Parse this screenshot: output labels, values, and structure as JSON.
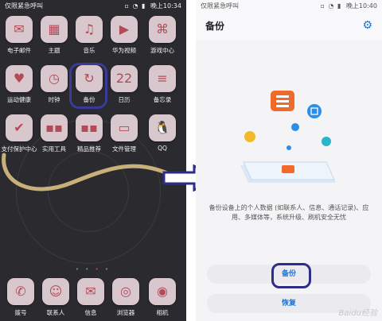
{
  "left_screen": {
    "status": {
      "carrier": "仅限紧急呼叫",
      "time": "晚上10:34"
    },
    "apps": [
      {
        "label": "电子邮件",
        "icon": "mail-icon",
        "glyph": "✉"
      },
      {
        "label": "主题",
        "icon": "theme-icon",
        "glyph": "▦"
      },
      {
        "label": "音乐",
        "icon": "music-icon",
        "glyph": "♫"
      },
      {
        "label": "华为视频",
        "icon": "video-icon",
        "glyph": "▶"
      },
      {
        "label": "游戏中心",
        "icon": "game-icon",
        "glyph": "⌘"
      },
      {
        "label": "运动健康",
        "icon": "health-icon",
        "glyph": "♥"
      },
      {
        "label": "时钟",
        "icon": "clock-icon",
        "glyph": "◷"
      },
      {
        "label": "备份",
        "icon": "backup-icon",
        "glyph": "↻"
      },
      {
        "label": "日历",
        "icon": "calendar-icon",
        "glyph": "22"
      },
      {
        "label": "备忘录",
        "icon": "memo-icon",
        "glyph": "≡"
      },
      {
        "label": "支付保护中心",
        "icon": "shield-icon",
        "glyph": "✔"
      },
      {
        "label": "实用工具",
        "icon": "tools-folder-icon",
        "glyph": "▪▪"
      },
      {
        "label": "精品推荐",
        "icon": "recommend-folder-icon",
        "glyph": "▪▪"
      },
      {
        "label": "文件管理",
        "icon": "folder-icon",
        "glyph": "▭"
      },
      {
        "label": "QQ",
        "icon": "qq-icon",
        "glyph": "🐧"
      }
    ],
    "dock": [
      {
        "label": "拨号",
        "icon": "phone-icon",
        "glyph": "✆"
      },
      {
        "label": "联系人",
        "icon": "contacts-icon",
        "glyph": "☺"
      },
      {
        "label": "信息",
        "icon": "message-icon",
        "glyph": "✉"
      },
      {
        "label": "浏览器",
        "icon": "browser-icon",
        "glyph": "◎"
      },
      {
        "label": "相机",
        "icon": "camera-icon",
        "glyph": "◉"
      }
    ]
  },
  "right_screen": {
    "status": {
      "carrier": "仅限紧急呼叫",
      "time": "晚上10:40"
    },
    "title": "备份",
    "settings_icon": "gear-icon",
    "description": "备份设备上的个人数据 (如联系人、信息、通话记录)、应用、多媒体等，系统升级、刷机安全无忧",
    "backup_button": "备份",
    "restore_button": "恢复",
    "watermark": "Baidu经验"
  },
  "colors": {
    "accent": "#1a73d9",
    "highlight": "#2e2e8a"
  }
}
